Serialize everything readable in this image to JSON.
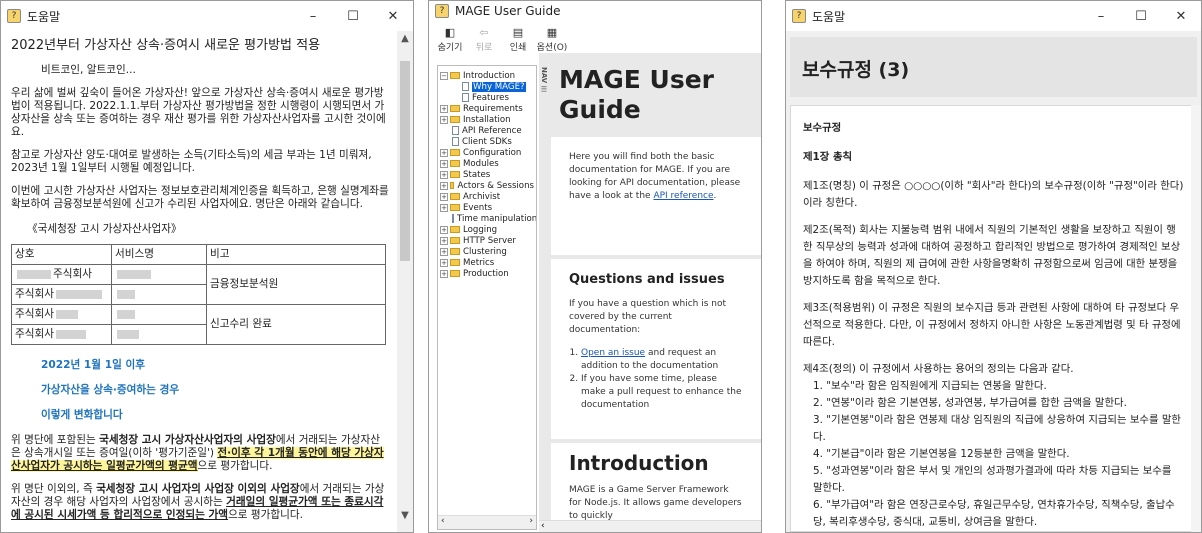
{
  "win1": {
    "title": "도움말",
    "heading": "2022년부터 가상자산 상속·증여시 새로운 평가방법 적용",
    "sub": "비트코인, 알트코인...",
    "p1": "우리 삶에 벌써 깊숙이 들어온 가상자산! 앞으로 가상자산 상속·증여시 새로운 평가방법이 적용됩니다. 2022.1.1.부터 가상자산 평가방법을 정한 시행령이 시행되면서 가상자산을 상속 또는 증여하는 경우 재산 평가를 위한 가상자산사업자를 고시한 것이에요.",
    "p2": "참고로 가상자산 양도·대여로 발생하는 소득(기타소득)의 세금 부과는 1년 미뤄져, 2023년 1월 1일부터 시행될 예정입니다.",
    "p3": "이번에 고시한 가상자산 사업자는 정보보호관리체계인증을 획득하고, 은행 실명계좌를 확보하여 금융정보분석원에 신고가 수리된 사업자에요. 명단은 아래와 같습니다.",
    "table_caption": "《국세청장 고시 가상자산사업자》",
    "table": {
      "headers": [
        "상호",
        "서비스명",
        "비고"
      ],
      "row1_suffix": "주식회사",
      "row_prefix": "주식회사",
      "note1": "금융정보분석원",
      "note2": "신고수리 완료"
    },
    "blue1": "2022년 1월 1일 이후",
    "blue2": "가상자산을 상속·증여하는 경우",
    "blue3": "이렇게 변화합니다",
    "p4a": "위 명단에 포함된는 ",
    "p4b": "국세청장 고시 가상자산사업자의 사업장",
    "p4c": "에서 거래되는 가상자산은 상속개시일 또는 증여일(이하 '평가기준일') ",
    "p4d": "전·이후 각 1개월 동안에 해당 가상자산사업자가 공시하는 일평균가액의 평균액",
    "p4e": "으로 평가합니다.",
    "p5a": "위 명단 이외의, 즉 ",
    "p5b": "국세청장 고시 사업자의 사업장 이외의 사업장",
    "p5c": "에서 거래되는 가상자산의 경우 해당 사업자의 사업장에서 공시하는 ",
    "p5d": "거래일의 일평균가액 또는 종료시각에 공시된 시세가액 등 합리적으로 인정되는 가액",
    "p5e": "으로 평가합니다."
  },
  "win2": {
    "title": "MAGE User Guide",
    "toolbar": [
      "숨기기",
      "뒤로",
      "인쇄",
      "옵션(O)"
    ],
    "tree": [
      {
        "label": "Introduction",
        "kind": "folder-open"
      },
      {
        "label": "Why MAGE?",
        "kind": "page-sel"
      },
      {
        "label": "Features",
        "kind": "page"
      },
      {
        "label": "Requirements",
        "kind": "folder"
      },
      {
        "label": "Installation",
        "kind": "folder"
      },
      {
        "label": "API Reference",
        "kind": "page-top"
      },
      {
        "label": "Client SDKs",
        "kind": "page-top"
      },
      {
        "label": "Configuration",
        "kind": "folder"
      },
      {
        "label": "Modules",
        "kind": "folder"
      },
      {
        "label": "States",
        "kind": "folder"
      },
      {
        "label": "Actors & Sessions",
        "kind": "folder"
      },
      {
        "label": "Archivist",
        "kind": "folder"
      },
      {
        "label": "Events",
        "kind": "folder"
      },
      {
        "label": "Time manipulation",
        "kind": "page-top"
      },
      {
        "label": "Logging",
        "kind": "folder"
      },
      {
        "label": "HTTP Server",
        "kind": "folder"
      },
      {
        "label": "Clustering",
        "kind": "folder"
      },
      {
        "label": "Metrics",
        "kind": "folder"
      },
      {
        "label": "Production",
        "kind": "folder"
      }
    ],
    "nav_label": "NAV ☰",
    "page_title": "MAGE User Guide",
    "intro_text": "Here you will find both the basic documentation for MAGE. If you are looking for API documentation, please have a look at the ",
    "api_link": "API reference",
    "api_after": ".",
    "questions_title": "Questions and issues",
    "questions_text": "If you have a question which is not covered by the current documentation:",
    "q1_link": "Open an issue",
    "q1_text": " and request an addition to the documentation",
    "q2_text": "If you have some time, please make a pull request to enhance the documentation",
    "intro_title": "Introduction",
    "intro_body": "MAGE is a Game Server Framework for Node.js. It allows game developers to quickly"
  },
  "win3": {
    "title": "도움말",
    "page_title": "보수규정 (3)",
    "section": "보수규정",
    "chapter": "제1장 총칙",
    "a1": "제1조(명칭) 이 규정은 ○○○○(이하 \"회사\"라 한다)의 보수규정(이하 \"규정\"이라 한다)이라 칭한다.",
    "a2": "제2조(목적) 회사는 지불능력 범위 내에서 직원의 기본적인 생활을 보장하고 직원이 행한 직무상의 능력과 성과에 대하여 공정하고 합리적인 방법으로 평가하여 경제적인 보상을 하여야 하며, 직원의 제 급여에 관한 사항을명확히 규정함으로써 임금에 대한 분쟁을 방지하도록 함을 목적으로 한다.",
    "a3": "제3조(적용범위) 이 규정은 직원의 보수지급 등과 관련된 사항에 대하여 타 규정보다 우선적으로 적용한다. 다만, 이 규정에서 정하지 아니한 사항은 노동관계법령 및 타 규정에 따른다.",
    "a4": "제4조(정의) 이 규정에서 사용하는 용어의 정의는 다음과 같다.",
    "d1": "1. \"보수\"라 함은 임직원에게 지급되는 연봉을 말한다.",
    "d2": "2. \"연봉\"이라 함은 기본연봉, 성과연봉, 부가급여를 합한 금액을 말한다.",
    "d3": "3. \"기본연봉\"이라 함은 연봉제 대상 임직원의 직급에 상응하여 지급되는 보수를 말한다.",
    "d4": "4. \"기본급\"이라 함은 기본연봉을 12등분한 금액을 말한다.",
    "d5": "5. \"성과연봉\"이라 함은 부서 및 개인의 성과평가결과에 따라 차등 지급되는 보수를 말한다.",
    "d6": "6. \"부가급여\"라 함은 연장근로수당, 휴일근무수당, 연차휴가수당, 직책수당, 출납수당, 복리후생수당, 중식대, 교통비, 상여금을 말한다."
  }
}
